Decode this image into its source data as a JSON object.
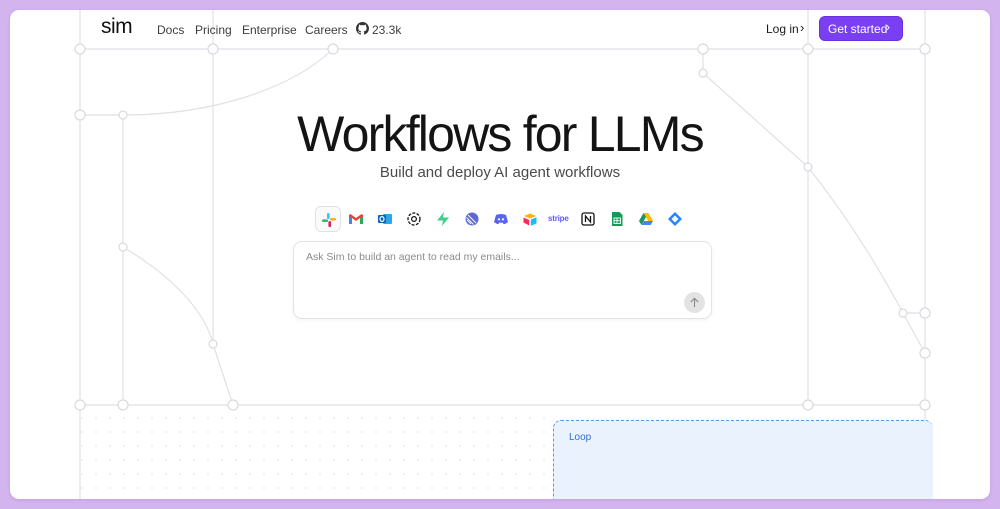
{
  "brand": {
    "logo": "sim"
  },
  "nav": {
    "links": [
      "Docs",
      "Pricing",
      "Enterprise",
      "Careers"
    ],
    "github_stars": "23.3k",
    "login_label": "Log in",
    "cta_label": "Get started"
  },
  "hero": {
    "title": "Workflows for LLMs",
    "subtitle": "Build and deploy AI agent workflows"
  },
  "integrations": [
    "slack",
    "gmail",
    "outlook",
    "openai",
    "supabase",
    "linear",
    "discord",
    "airtable",
    "stripe",
    "notion",
    "google-sheets",
    "google-drive",
    "jira"
  ],
  "integration_text": {
    "stripe": "stripe"
  },
  "prompt": {
    "placeholder": "Ask Sim to build an agent to read my emails..."
  },
  "canvas": {
    "loop_label": "Loop"
  },
  "colors": {
    "accent": "#7a3ff0",
    "loop_border": "#5d97e8",
    "loop_fill": "#eaf2fd",
    "page_bg": "#d4b4ef"
  }
}
